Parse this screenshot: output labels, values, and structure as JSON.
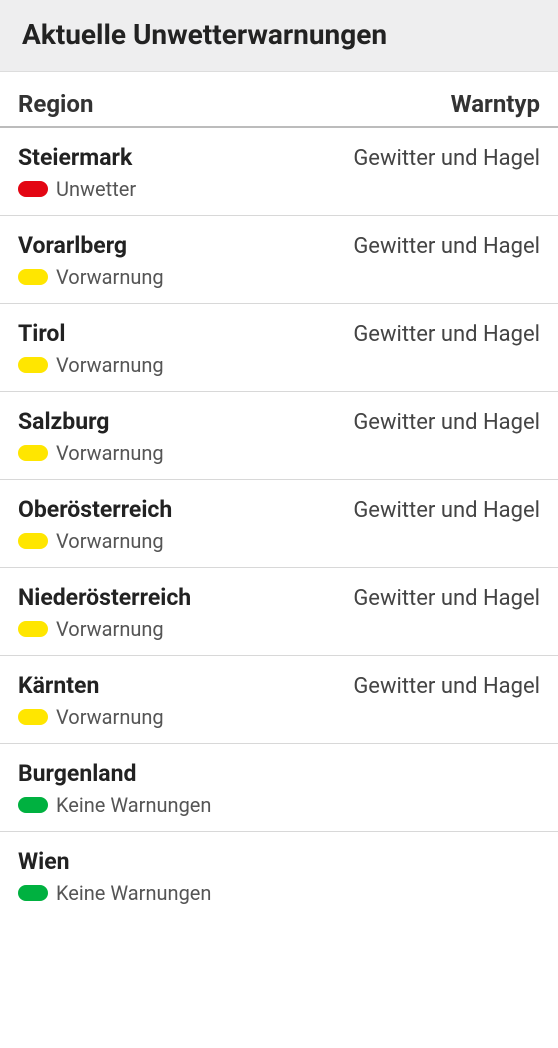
{
  "title": "Aktuelle Unwetterwarnungen",
  "columns": {
    "region": "Region",
    "warntyp": "Warntyp"
  },
  "status_colors": {
    "unwetter": "#e30613",
    "vorwarnung": "#ffe600",
    "keine": "#00b140"
  },
  "rows": [
    {
      "region": "Steiermark",
      "status_key": "unwetter",
      "status_label": "Unwetter",
      "warntyp": "Gewitter und Hagel"
    },
    {
      "region": "Vorarlberg",
      "status_key": "vorwarnung",
      "status_label": "Vorwarnung",
      "warntyp": "Gewitter und Hagel"
    },
    {
      "region": "Tirol",
      "status_key": "vorwarnung",
      "status_label": "Vorwarnung",
      "warntyp": "Gewitter und Hagel"
    },
    {
      "region": "Salzburg",
      "status_key": "vorwarnung",
      "status_label": "Vorwarnung",
      "warntyp": "Gewitter und Hagel"
    },
    {
      "region": "Oberösterreich",
      "status_key": "vorwarnung",
      "status_label": "Vorwarnung",
      "warntyp": "Gewitter und Hagel"
    },
    {
      "region": "Niederösterreich",
      "status_key": "vorwarnung",
      "status_label": "Vorwarnung",
      "warntyp": "Gewitter und Hagel"
    },
    {
      "region": "Kärnten",
      "status_key": "vorwarnung",
      "status_label": "Vorwarnung",
      "warntyp": "Gewitter und Hagel"
    },
    {
      "region": "Burgenland",
      "status_key": "keine",
      "status_label": "Keine Warnungen",
      "warntyp": ""
    },
    {
      "region": "Wien",
      "status_key": "keine",
      "status_label": "Keine Warnungen",
      "warntyp": ""
    }
  ]
}
